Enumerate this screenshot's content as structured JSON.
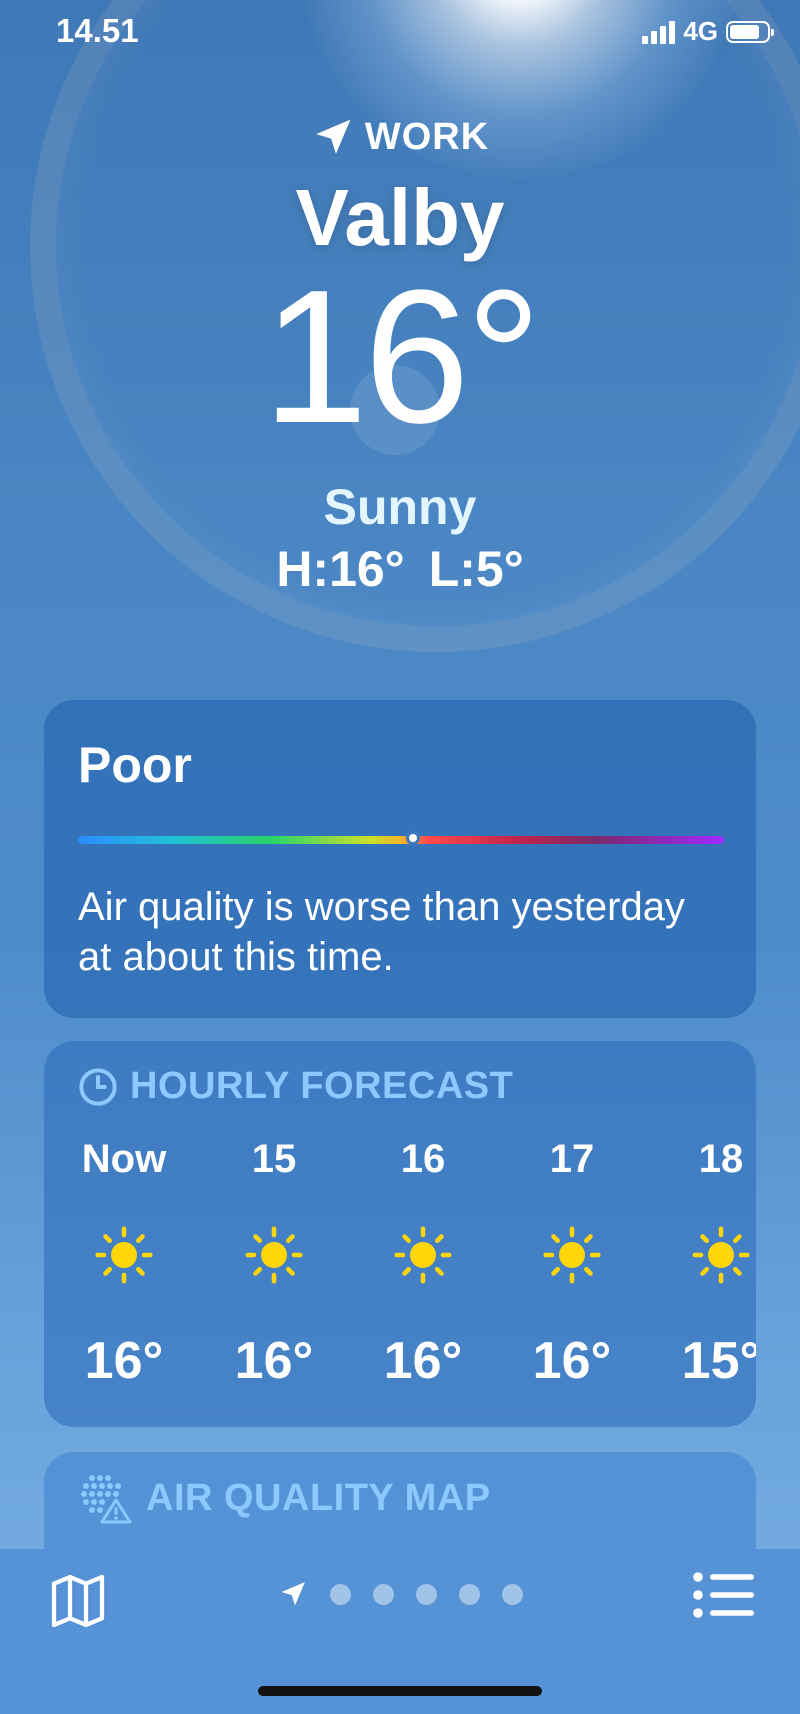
{
  "status_bar": {
    "time": "14.51",
    "network": "4G",
    "battery_level": 0.8
  },
  "header": {
    "location_label": "WORK",
    "city": "Valby",
    "temperature": "16°",
    "condition": "Sunny",
    "high": "H:16°",
    "low": "L:5°"
  },
  "air_quality": {
    "level": "Poor",
    "description": "Air quality is worse than yesterday at about this time.",
    "scale_position": 0.5
  },
  "hourly": {
    "title": "HOURLY FORECAST",
    "items": [
      {
        "time": "Now",
        "icon": "sun-icon",
        "temp": "16°"
      },
      {
        "time": "15",
        "icon": "sun-icon",
        "temp": "16°"
      },
      {
        "time": "16",
        "icon": "sun-icon",
        "temp": "16°"
      },
      {
        "time": "17",
        "icon": "sun-icon",
        "temp": "16°"
      },
      {
        "time": "18",
        "icon": "sun-icon",
        "temp": "15°"
      }
    ]
  },
  "air_quality_map": {
    "title": "AIR QUALITY MAP"
  },
  "bottom_bar": {
    "pages": 5,
    "current_page_icon": "location-arrow-icon"
  },
  "colors": {
    "accent_header": "#8dc9ff",
    "sun": "#ffd60a",
    "background": "#4a86c3"
  }
}
